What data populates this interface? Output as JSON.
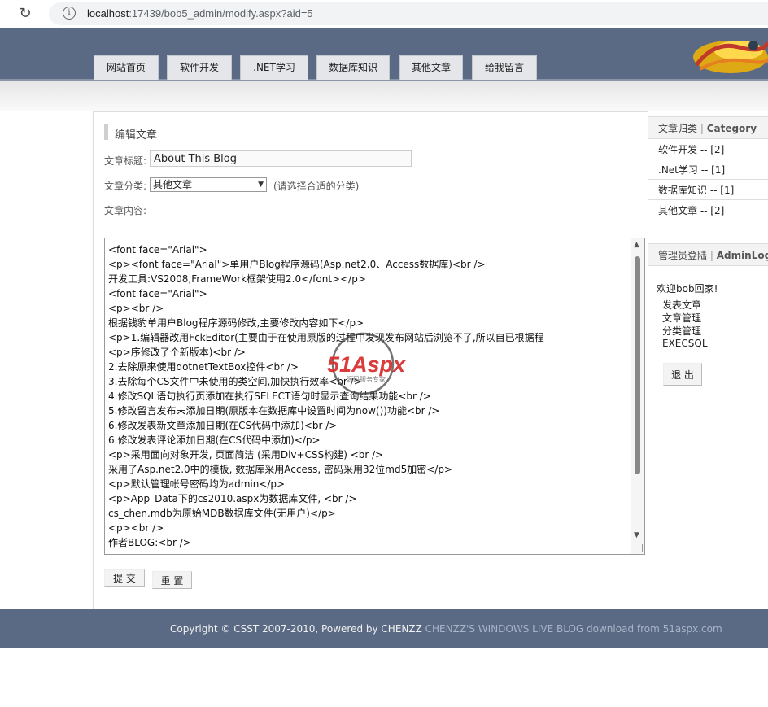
{
  "browser": {
    "url_host": "localhost",
    "url_rest": ":17439/bob5_admin/modify.aspx?aid=5"
  },
  "nav": [
    "网站首页",
    "软件开发",
    ".NET学习",
    "数据库知识",
    "其他文章",
    "给我留言"
  ],
  "editor": {
    "section_title": "编辑文章",
    "title_label": "文章标题:",
    "title_value": "About This Blog",
    "category_label": "文章分类:",
    "category_value": "其他文章",
    "category_hint": "(请选择合适的分类)",
    "content_label": "文章内容:",
    "content_lines": [
      "<font face=\"Arial\">",
      "<p><font face=\"Arial\">单用户Blog程序源码(Asp.net2.0、Access数据库)<br />",
      "开发工具:VS2008,FrameWork框架使用2.0</font></p>",
      "<font face=\"Arial\">",
      "<p><br />",
      "根据钱豹单用户Blog程序源码修改,主要修改内容如下</p>",
      "<p>1.编辑器改用FckEditor(主要由于在使用原版的过程中发现发布网站后浏览不了,所以自已根据程",
      "<p>序修改了个新版本)<br />",
      "2.去除原来使用dotnetTextBox控件<br />",
      "3.去除每个CS文件中未使用的类空间,加快执行效率<br />",
      "4.修改SQL语句执行页添加在执行SELECT语句时显示查询结果功能<br />",
      "5.修改留言发布未添加日期(原版本在数据库中设置时间为now())功能<br />",
      "6.修改发表新文章添加日期(在CS代码中添加)<br />",
      "6.修改发表评论添加日期(在CS代码中添加)</p>",
      "<p>采用面向对象开发, 页面简洁 (采用Div+CSS构建) <br />",
      "采用了Asp.net2.0中的模板, 数据库采用Access, 密码采用32位md5加密</p>",
      "<p>默认管理帐号密码均为admin</p>",
      "<p>App_Data下的cs2010.aspx为数据库文件, <br />",
      "cs_chen.mdb为原始MDB数据库文件(无用户)</p>",
      "<p><br />",
      "作者BLOG:<br />"
    ],
    "submit_label": "提 交",
    "reset_label": "重 置"
  },
  "watermark": {
    "brand": "51Aspx",
    "tagline": "源码服务专家"
  },
  "sidebar": {
    "category_head_cn": "文章归类",
    "category_head_en": "Category",
    "categories": [
      "软件开发 -- [2]",
      ".Net学习 -- [1]",
      "数据库知识 -- [1]",
      "其他文章 -- [2]"
    ],
    "admin_head_cn": "管理员登陆",
    "admin_head_en": "AdminLogin",
    "welcome": "欢迎bob回家!",
    "admin_links": [
      "发表文章",
      "文章管理",
      "分类管理",
      "EXECSQL"
    ],
    "logout_label": "退 出"
  },
  "footer": {
    "copyright": "Copyright © CSST 2007-2010, Powered by CHENZZ",
    "tagline": "CHENZZ'S WINDOWS LIVE BLOG download from 51aspx.com"
  }
}
